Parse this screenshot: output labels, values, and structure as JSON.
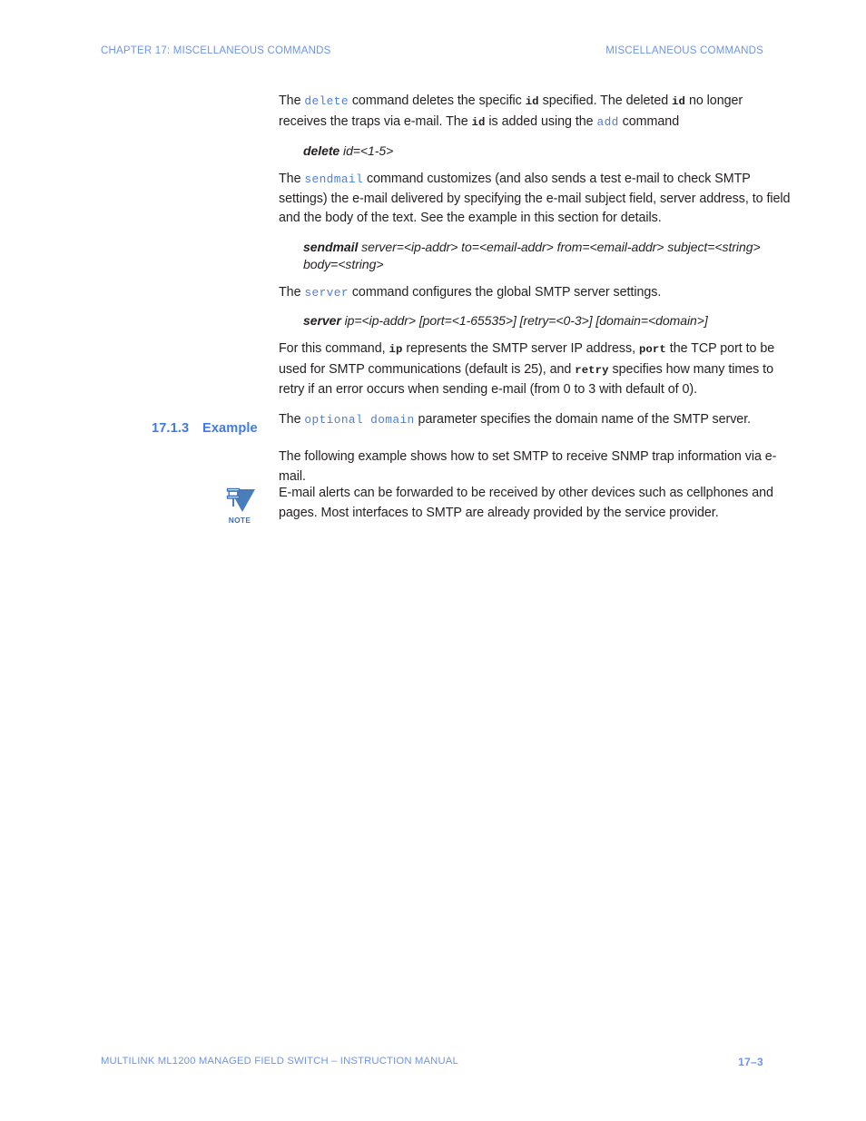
{
  "header": {
    "left": "CHAPTER 17: MISCELLANEOUS COMMANDS",
    "right": "MISCELLANEOUS COMMANDS",
    "color": "#6f94e8"
  },
  "body": {
    "delete_para": {
      "t1": "The ",
      "kw1": "delete",
      "t2": " command deletes the specific ",
      "mono1": "id",
      "t3": " specified. The deleted ",
      "mono2": "id",
      "t4": " no longer receives the traps via e-mail. The ",
      "mono3": "id",
      "t5": " is added using the ",
      "kw2": "add",
      "t6": " command"
    },
    "delete_syntax": {
      "cmd": "delete",
      "args": " id=<1-5>"
    },
    "sendmail_para": {
      "t1": "The ",
      "kw1": "sendmail",
      "t2": " command customizes (and also sends a test e-mail to check SMTP settings) the e-mail delivered by specifying the e-mail subject field, server address, to field and the body of the text. See the example in this section for details."
    },
    "sendmail_syntax": {
      "cmd": "sendmail",
      "args": " server=<ip-addr> to=<email-addr> from=<email-addr> subject=<string> body=<string>"
    },
    "server_para": {
      "t1": "The ",
      "kw1": "server",
      "t2": " command configures the global SMTP server settings."
    },
    "server_syntax": {
      "cmd": "server",
      "args": " ip=<ip-addr> [port=<1-65535>] [retry=<0-3>] [domain=<domain>]"
    },
    "forcommand_para": {
      "t1": "For this command, ",
      "mono1": "ip",
      "t2": " represents the SMTP server IP address, ",
      "mono2": "port",
      "t3": " the TCP port to be used for SMTP communications (default is 25), and ",
      "mono3": "retry",
      "t4": " specifies how many times to retry if an error occurs when sending e-mail (from 0 to 3 with default of 0)."
    },
    "optional_para": {
      "t1": "The ",
      "kw1": "optional domain",
      "t2": " parameter specifies the domain name of the SMTP server."
    }
  },
  "section": {
    "number": "17.1.3",
    "title": "Example",
    "color": "#3f7ae8"
  },
  "example": {
    "intro": "The following example shows how to set SMTP to receive SNMP trap information via e-mail."
  },
  "note": {
    "icon_name": "note-pushpin-icon",
    "label": "NOTE",
    "icon_color": "#4a7ebb",
    "text": "E-mail alerts can be forwarded to be received by other devices such as cellphones and pages. Most interfaces to SMTP are already provided by the service provider."
  },
  "footer": {
    "left": "MULTILINK ML1200 MANAGED FIELD SWITCH – INSTRUCTION MANUAL",
    "page": "17–3",
    "color": "#6f94e8"
  }
}
